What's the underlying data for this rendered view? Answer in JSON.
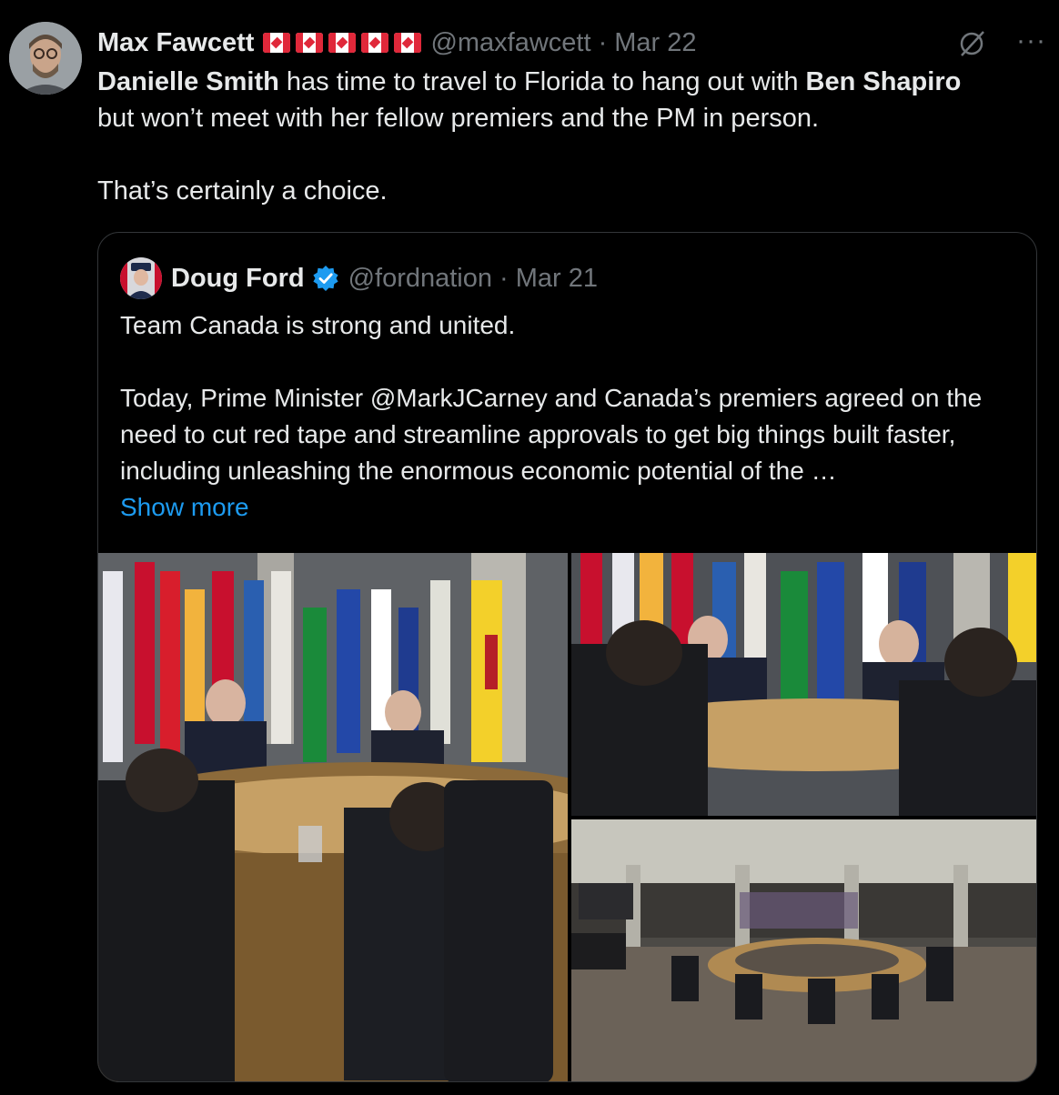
{
  "tweet": {
    "author_name": "Max Fawcett",
    "flag_count": 5,
    "handle": "@maxfawcett",
    "separator": "·",
    "date": "Mar 22",
    "text_line1_bold1": "Danielle Smith",
    "text_line1_mid": " has time to travel to Florida to hang out with ",
    "text_line1_bold2": "Ben Shapiro",
    "text_line2": "but won’t meet with her fellow premiers and the PM in person.",
    "text_line3": "That’s certainly a choice.",
    "more_label": "···"
  },
  "quote": {
    "author_name": "Doug Ford",
    "handle": "@fordnation",
    "separator": "·",
    "date": "Mar 21",
    "para1": "Team Canada is strong and united.",
    "para2": "Today, Prime Minister @MarkJCarney and Canada’s premiers agreed on the need to cut red tape and streamline approvals to get big things built faster, including unleashing the enormous economic potential of the …",
    "show_more": "Show more"
  },
  "icons": {
    "flag": "canada-flag-icon",
    "grok": "grok-icon",
    "more": "more-icon",
    "verified": "verified-badge-icon"
  },
  "colors": {
    "background": "#000000",
    "text": "#e7e9ea",
    "muted": "#71767b",
    "link": "#1d9bf0",
    "border": "#333639"
  }
}
